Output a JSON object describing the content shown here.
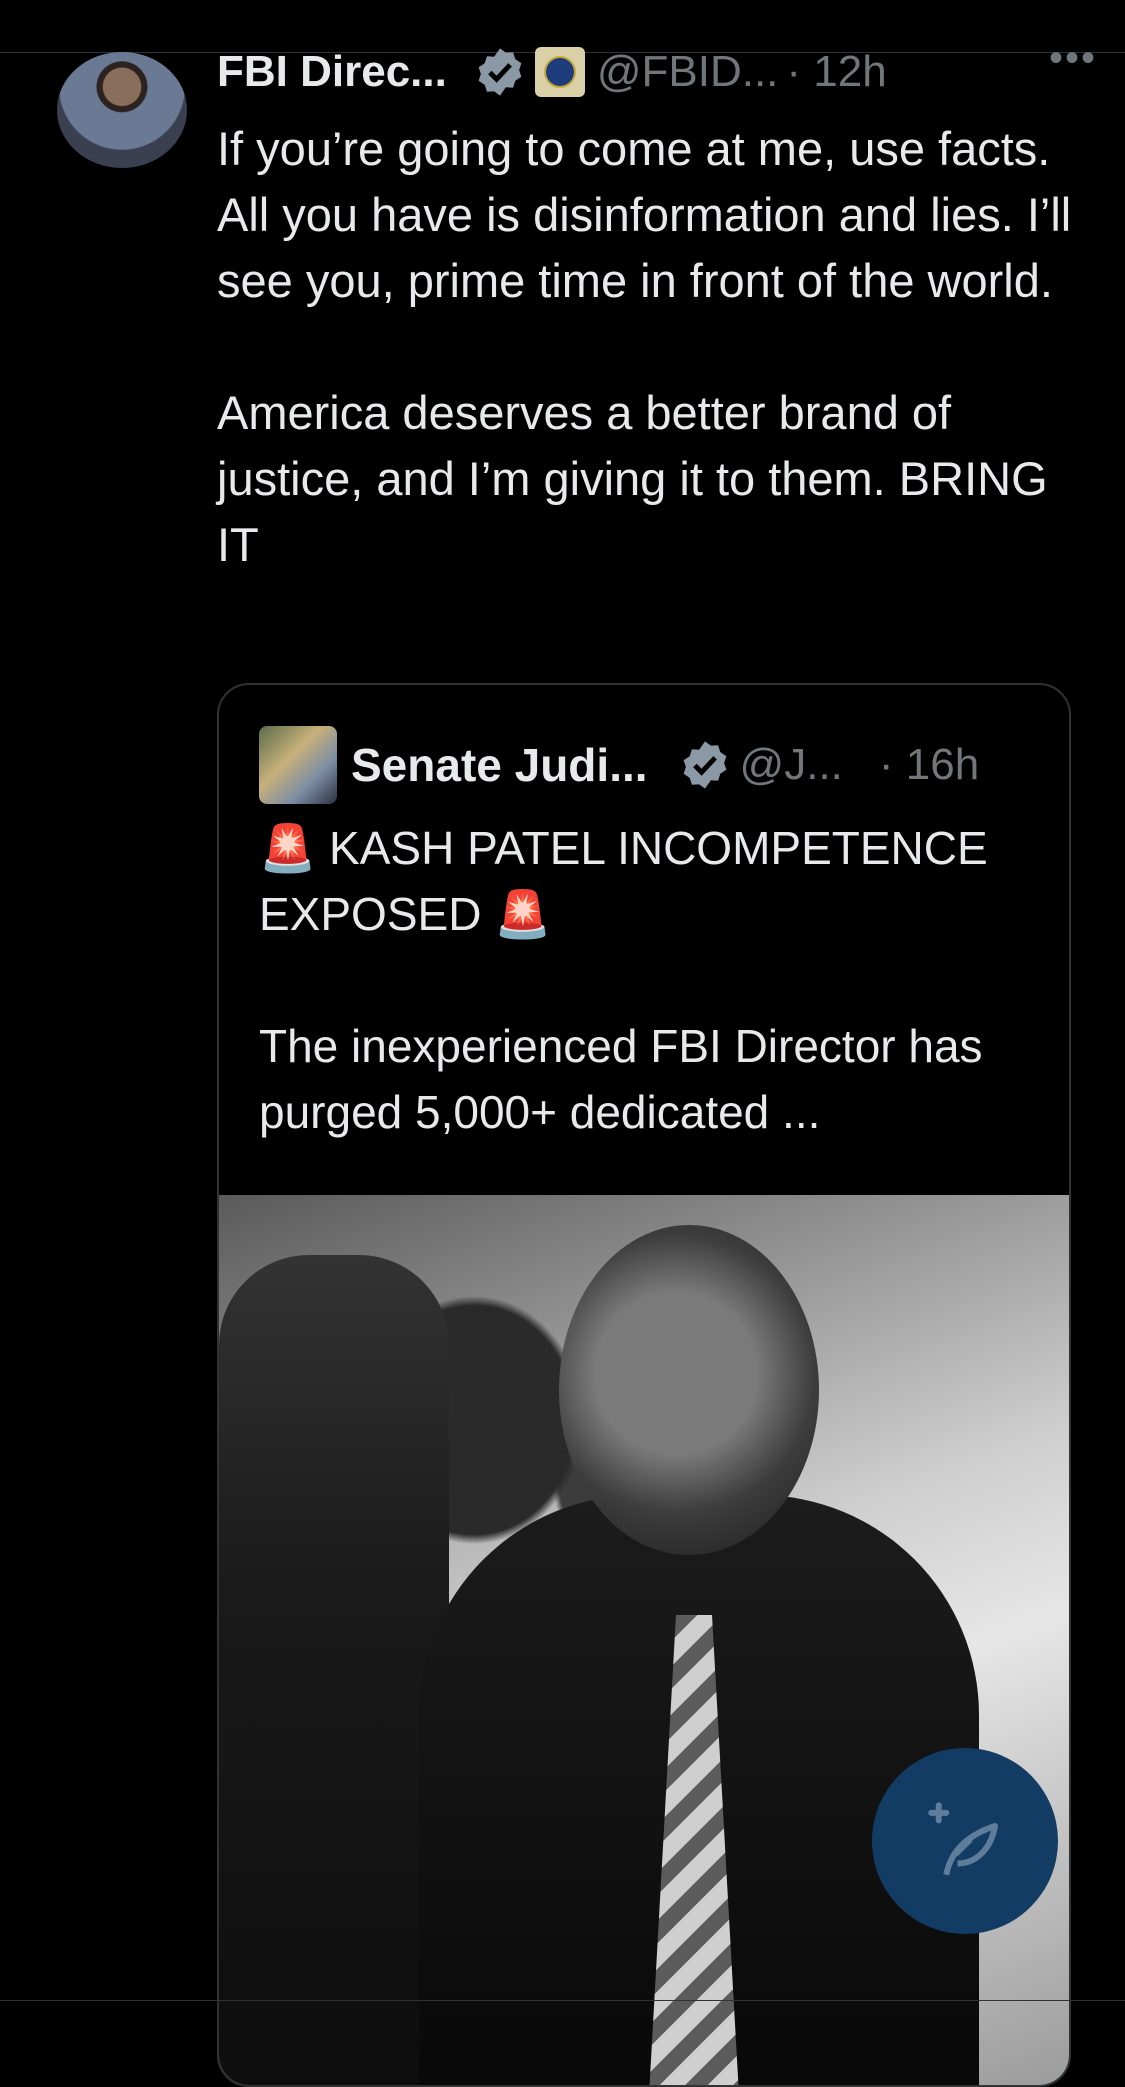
{
  "author": {
    "display_name": "FBI Direc...",
    "handle": "@FBID...",
    "time": "· 12h",
    "verified_icon": "verified-badge-icon",
    "affiliation_icon": "fbi-seal-icon"
  },
  "more_label": "•••",
  "tweet": {
    "text": "If you’re going to come at me, use facts. All you have is disinformation and lies. I’ll see you, prime time in front of the world.\n\nAmerica deserves a better brand of justice, and I’m giving it to them. BRING IT"
  },
  "quoted": {
    "display_name": "Senate Judi...",
    "handle": "@J...",
    "time": "· 16h",
    "text": "🚨 KASH PATEL INCOMPETENCE EXPOSED 🚨\n\nThe inexperienced FBI Director has purged 5,000+ dedicated ...",
    "media": "photo"
  },
  "compose_button": {
    "icon": "compose-feather-icon"
  },
  "colors": {
    "background": "#000000",
    "text": "#e7e9ea",
    "muted": "#71767b",
    "border": "#2f3336",
    "fab": "#123c63"
  }
}
